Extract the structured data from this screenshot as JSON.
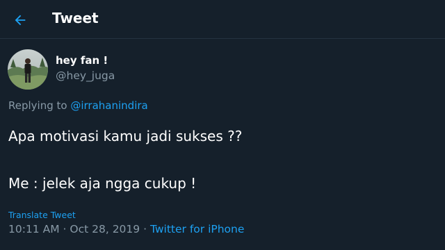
{
  "header": {
    "title": "Tweet",
    "back_icon": "arrow-left-icon",
    "accent": "#1da1f2"
  },
  "author": {
    "display_name": "hey fan !",
    "handle": "@hey_juga"
  },
  "reply": {
    "prefix": "Replying to",
    "mention": "@irrahanindira"
  },
  "tweet": {
    "line1": "Apa motivasi kamu jadi sukses ??",
    "line2": "Me : jelek aja ngga cukup !"
  },
  "translate_label": "Translate Tweet",
  "meta": {
    "time": "10:11 AM",
    "separator": "·",
    "date": "Oct 28, 2019",
    "source": "Twitter for iPhone"
  },
  "colors": {
    "background": "#15202b",
    "text": "#ffffff",
    "muted": "#8899a6",
    "link": "#1da1f2"
  }
}
